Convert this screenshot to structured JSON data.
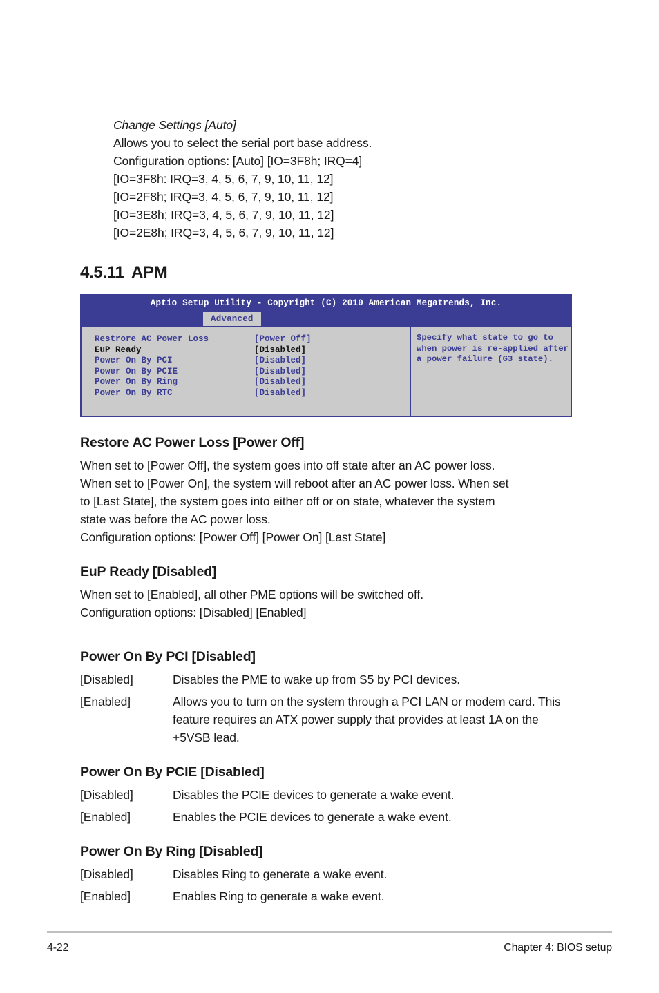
{
  "intro": {
    "lines": [
      "Change Settings [Auto]",
      "Allows you to select the serial port base address.",
      "Configuration options: [Auto] [IO=3F8h; IRQ=4]",
      "[IO=3F8h: IRQ=3, 4, 5, 6, 7, 9, 10, 11, 12]",
      "[IO=2F8h; IRQ=3, 4, 5, 6, 7, 9, 10, 11, 12]",
      "[IO=3E8h; IRQ=3, 4, 5, 6, 7, 9, 10, 11, 12]",
      "[IO=2E8h; IRQ=3, 4, 5, 6, 7, 9, 10, 11, 12]"
    ]
  },
  "section": {
    "number": "4.5.11",
    "title": "APM"
  },
  "bios": {
    "title": "Aptio Setup Utility - Copyright (C) 2010 American Megatrends, Inc.",
    "tab": "Advanced",
    "settings": [
      {
        "name": "Restrore AC Power Loss",
        "value": "[Power Off]",
        "selected": false
      },
      {
        "name": "EuP Ready",
        "value": "[Disabled]",
        "selected": true
      },
      {
        "name": "Power On By PCI",
        "value": "[Disabled]",
        "selected": false
      },
      {
        "name": "Power On By PCIE",
        "value": "[Disabled]",
        "selected": false
      },
      {
        "name": "Power On By Ring",
        "value": "[Disabled]",
        "selected": false
      },
      {
        "name": "Power On By RTC",
        "value": "[Disabled]",
        "selected": false
      }
    ],
    "help": [
      "Specify what state to go to",
      "when power is re-applied after",
      "a power failure (G3 state)."
    ],
    "colors": {
      "titlebar": "#3b3c93",
      "body_bg": "#cbcbcb",
      "text_blue": "#3b3c93",
      "text_selected": "#111111"
    }
  },
  "sections": {
    "restore": {
      "heading": "Restore AC Power Loss [Power Off]",
      "paragraph_lines": [
        "When set to [Power Off], the system goes into off state after an AC power loss.",
        "When set to [Power On], the system will reboot after an AC power loss. When set",
        "to [Last State], the system goes into either off or on state, whatever the system",
        "state was before the AC power loss.",
        "Configuration options: [Power Off] [Power On] [Last State]"
      ]
    },
    "eup": {
      "heading": "EuP Ready [Disabled]",
      "paragraph_lines": [
        "When set to [Enabled], all other PME options will be switched off.",
        "Configuration options: [Disabled] [Enabled]"
      ]
    },
    "pci": {
      "heading": "Power On By PCI [Disabled]",
      "rows": [
        {
          "term": "[Disabled]",
          "desc": "Disables the PME to wake up from S5 by PCI devices."
        },
        {
          "term": "[Enabled]",
          "desc": "Allows you to turn on the system through a PCI LAN or modem card. This feature requires an ATX power supply that provides at least 1A on the +5VSB lead."
        }
      ]
    },
    "pcie": {
      "heading": "Power On By PCIE [Disabled]",
      "rows": [
        {
          "term": "[Disabled]",
          "desc": "Disables the PCIE devices to generate a wake event."
        },
        {
          "term": "[Enabled]",
          "desc": "Enables the PCIE devices to generate a wake event."
        }
      ]
    },
    "ring": {
      "heading": "Power On By Ring [Disabled]",
      "rows": [
        {
          "term": "[Disabled]",
          "desc": "Disables Ring to generate a wake event."
        },
        {
          "term": "[Enabled]",
          "desc": "Enables Ring to generate a wake event."
        }
      ]
    }
  },
  "footer": {
    "page_number": "4-22",
    "chapter": "Chapter 4: BIOS setup"
  }
}
